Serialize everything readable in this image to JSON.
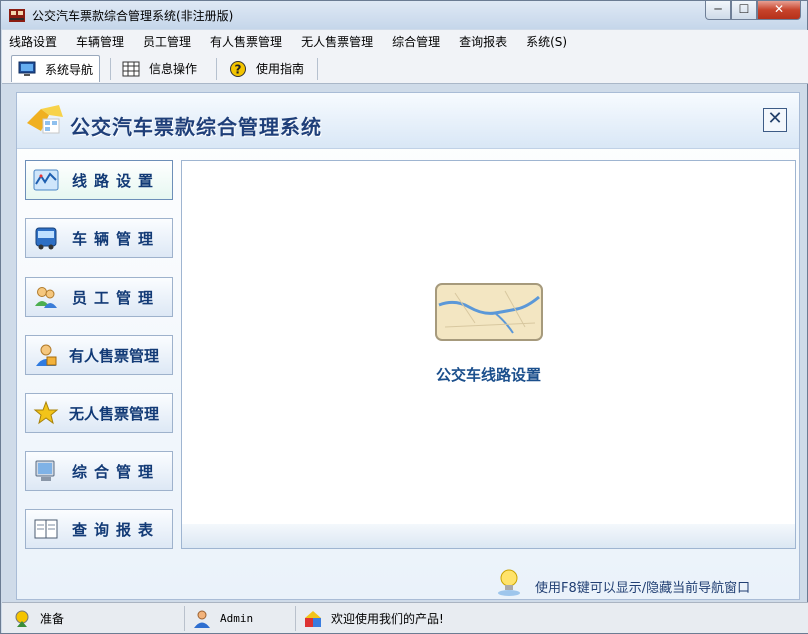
{
  "window": {
    "title": "公交汽车票款综合管理系统(非注册版)",
    "minimize": "─",
    "maximize": "☐",
    "close": "✕"
  },
  "menu": [
    "线路设置",
    "车辆管理",
    "员工管理",
    "有人售票管理",
    "无人售票管理",
    "综合管理",
    "查询报表",
    "系统(S)"
  ],
  "toolbar": {
    "tab_nav": "系统导航",
    "tab_info": "信息操作",
    "tab_guide": "使用指南"
  },
  "panel": {
    "title": "公交汽车票款综合管理系统",
    "close": "✕",
    "nav": [
      {
        "label": "线路设置",
        "icon": "route-icon"
      },
      {
        "label": "车辆管理",
        "icon": "bus-icon"
      },
      {
        "label": "员工管理",
        "icon": "staff-icon"
      },
      {
        "label": "有人售票管理",
        "icon": "conductor-icon"
      },
      {
        "label": "无人售票管理",
        "icon": "star-icon"
      },
      {
        "label": "综合管理",
        "icon": "monitor-icon"
      },
      {
        "label": "查询报表",
        "icon": "report-icon"
      }
    ],
    "content_caption": "公交车线路设置",
    "hint": "使用F8键可以显示/隐藏当前导航窗口"
  },
  "status": {
    "ready": "准备",
    "user": "Admin",
    "welcome": "欢迎使用我们的产品!"
  },
  "colors": {
    "accent": "#1f3f79",
    "nav_label": "#123a76",
    "caption": "#1b4f8c"
  }
}
